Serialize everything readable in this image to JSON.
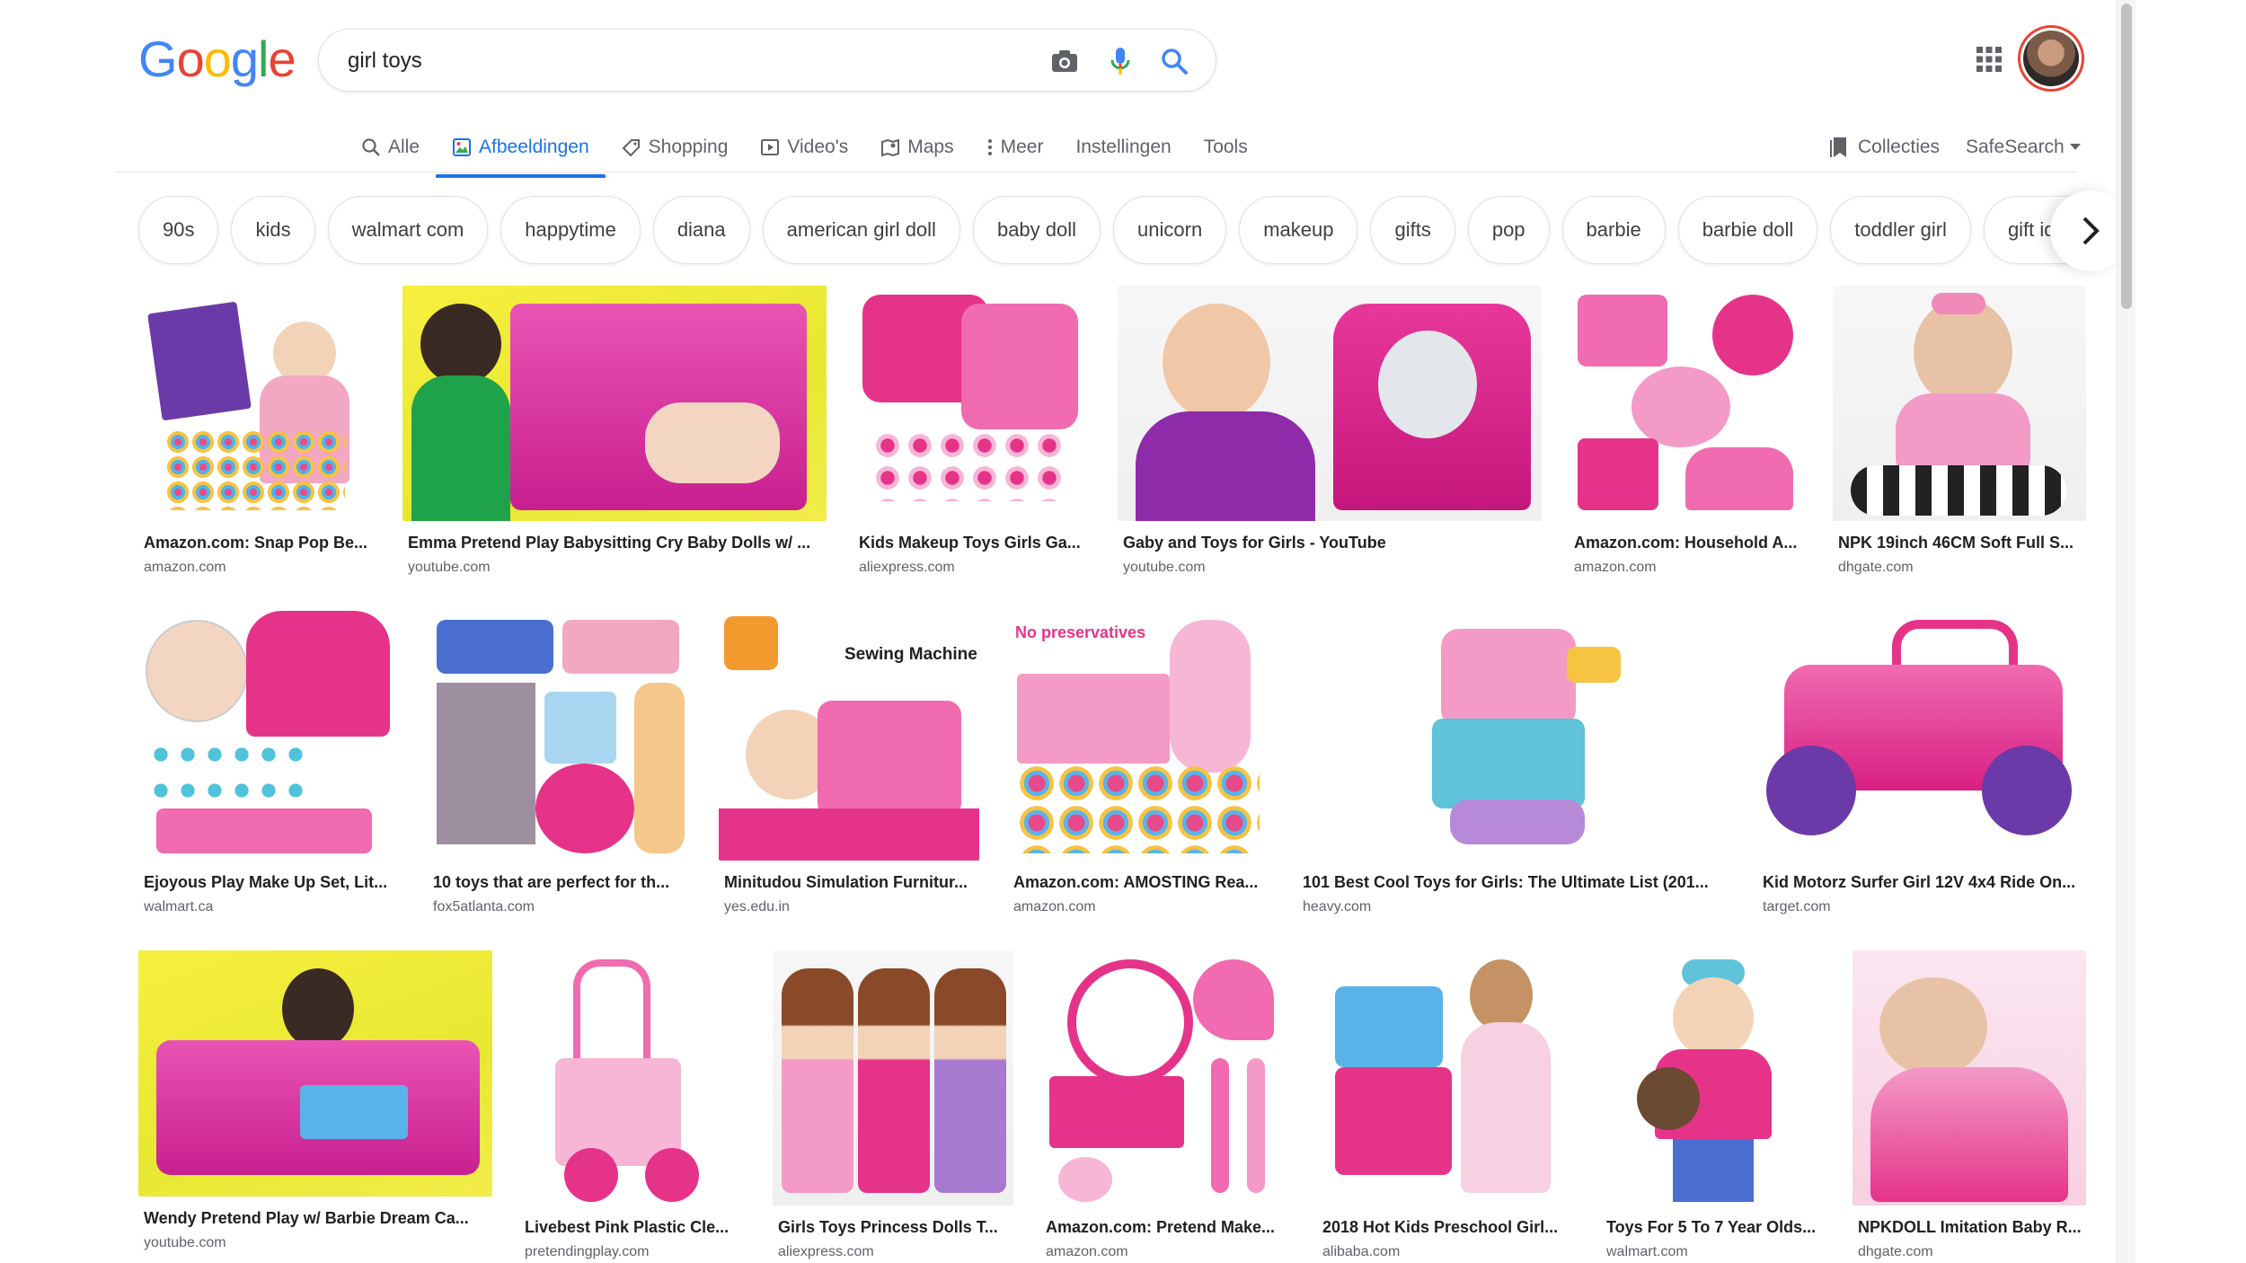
{
  "logo": {
    "letters": [
      "G",
      "o",
      "o",
      "g",
      "l",
      "e"
    ],
    "colors": [
      "#4285f4",
      "#ea4335",
      "#fbbc05",
      "#4285f4",
      "#34a853",
      "#ea4335"
    ]
  },
  "search": {
    "query": "girl toys"
  },
  "nav": {
    "items": [
      {
        "label": "Alle",
        "icon": "search-icon"
      },
      {
        "label": "Afbeeldingen",
        "icon": "image-icon",
        "active": true
      },
      {
        "label": "Shopping",
        "icon": "tag-icon"
      },
      {
        "label": "Video's",
        "icon": "play-icon"
      },
      {
        "label": "Maps",
        "icon": "map-icon"
      },
      {
        "label": "Meer",
        "icon": "more-vertical-icon"
      },
      {
        "label": "Instellingen"
      },
      {
        "label": "Tools"
      }
    ],
    "collections_label": "Collecties",
    "safesearch_label": "SafeSearch"
  },
  "chips": [
    "90s",
    "kids",
    "walmart com",
    "happytime",
    "diana",
    "american girl doll",
    "baby doll",
    "unicorn",
    "makeup",
    "gifts",
    "pop",
    "barbie",
    "barbie doll",
    "toddler girl",
    "gift ideas"
  ],
  "results": [
    {
      "title": "Amazon.com: Snap Pop Be...",
      "source": "amazon.com"
    },
    {
      "title": "Emma Pretend Play Babysitting Cry Baby Dolls w/ ...",
      "source": "youtube.com"
    },
    {
      "title": "Kids Makeup Toys Girls Ga...",
      "source": "aliexpress.com"
    },
    {
      "title": "Gaby and Toys for Girls - YouTube",
      "source": "youtube.com"
    },
    {
      "title": "Amazon.com: Household A...",
      "source": "amazon.com"
    },
    {
      "title": "NPK 19inch 46CM Soft Full S...",
      "source": "dhgate.com"
    },
    {
      "title": "Ejoyous Play Make Up Set, Lit...",
      "source": "walmart.ca"
    },
    {
      "title": "10 toys that are perfect for th...",
      "source": "fox5atlanta.com"
    },
    {
      "title": "Minitudou Simulation Furnitur...",
      "source": "yes.edu.in",
      "overlay": "Sewing Machine"
    },
    {
      "title": "Amazon.com: AMOSTING Rea...",
      "source": "amazon.com",
      "overlay": "No preservatives"
    },
    {
      "title": "101 Best Cool Toys for Girls: The Ultimate List (201...",
      "source": "heavy.com"
    },
    {
      "title": "Kid Motorz Surfer Girl 12V 4x4 Ride On...",
      "source": "target.com"
    },
    {
      "title": "Wendy Pretend Play w/ Barbie Dream Ca...",
      "source": "youtube.com"
    },
    {
      "title": "Livebest Pink Plastic Cle...",
      "source": "pretendingplay.com"
    },
    {
      "title": "Girls Toys Princess Dolls T...",
      "source": "aliexpress.com"
    },
    {
      "title": "Amazon.com: Pretend Make...",
      "source": "amazon.com"
    },
    {
      "title": "2018 Hot Kids Preschool Girl...",
      "source": "alibaba.com"
    },
    {
      "title": "Toys For 5 To 7 Year Olds...",
      "source": "walmart.com"
    },
    {
      "title": "NPKDOLL Imitation Baby R...",
      "source": "dhgate.com"
    }
  ],
  "colors": {
    "accent": "#1a73e8",
    "pink": "#e6338a",
    "text_secondary": "#5f6368"
  }
}
